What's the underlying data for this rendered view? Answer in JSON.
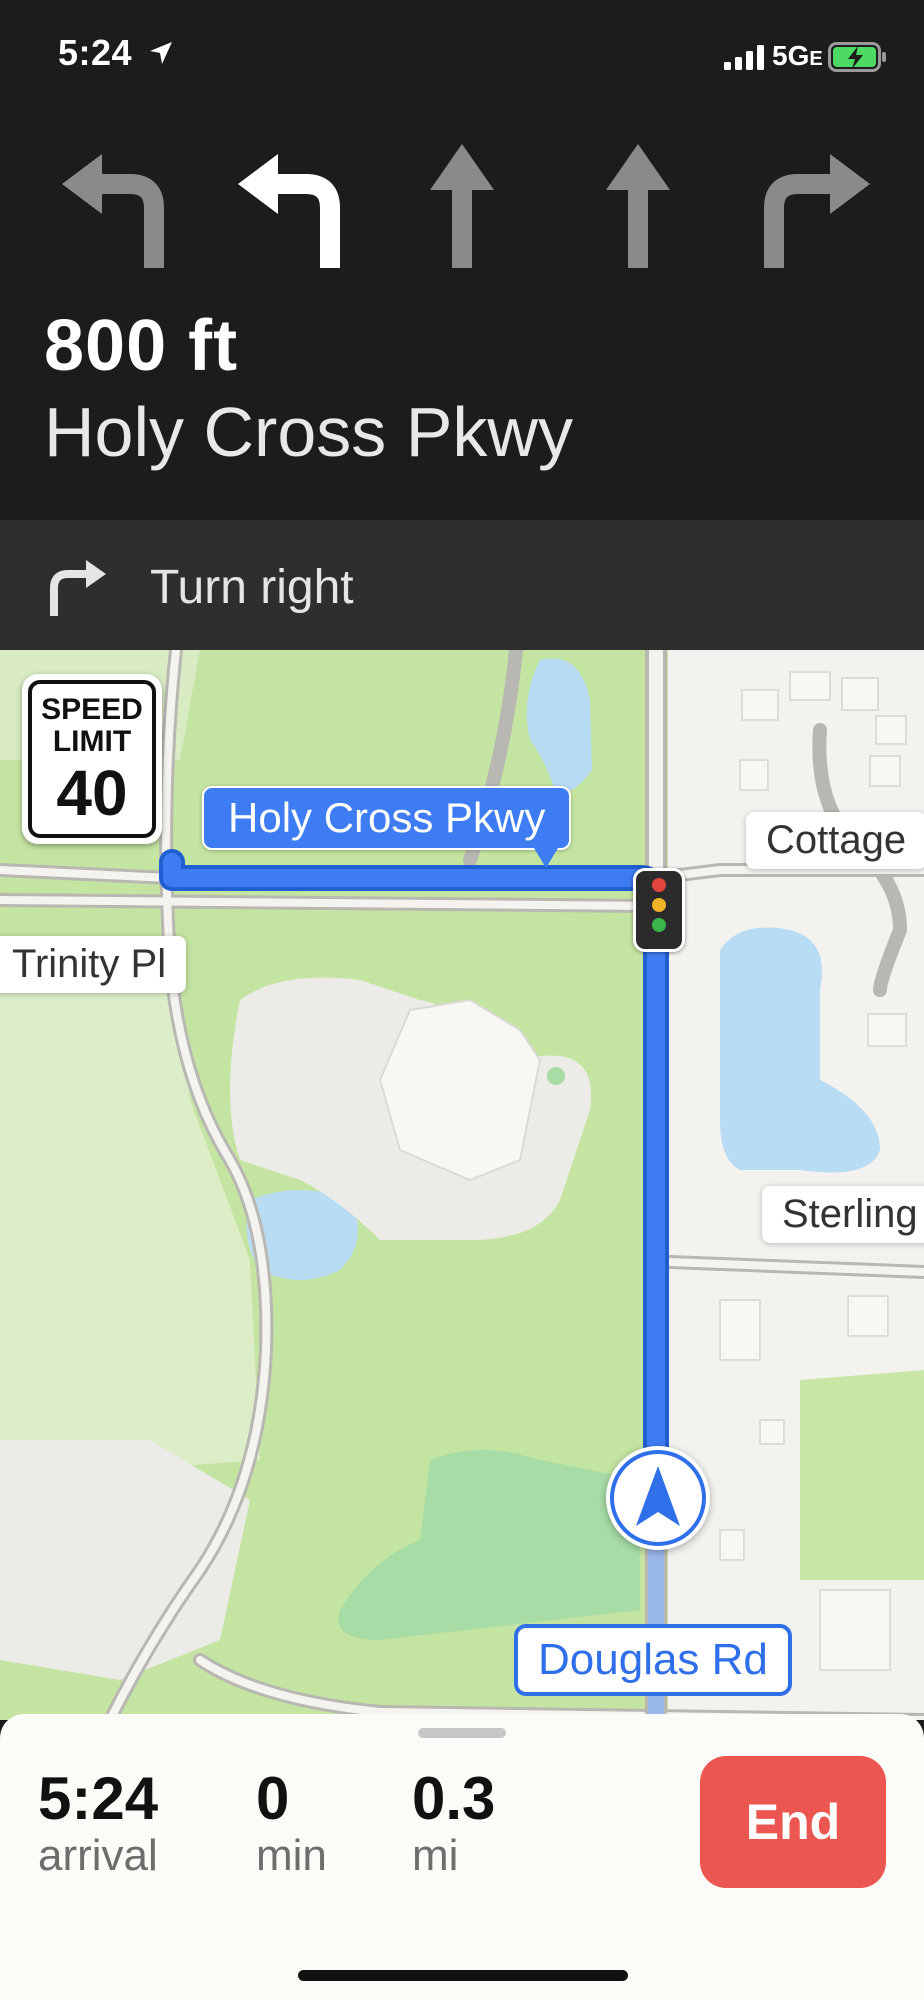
{
  "status_bar": {
    "time": "5:24",
    "network": "5G",
    "network_suffix": "E"
  },
  "guidance": {
    "distance": "800 ft",
    "street": "Holy Cross Pkwy",
    "lanes": [
      "left",
      "left-active",
      "straight",
      "straight",
      "right"
    ]
  },
  "next_maneuver": {
    "text": "Turn right",
    "icon": "turn-right-arrow"
  },
  "speed_sign": {
    "label_line1": "SPEED",
    "label_line2": "LIMIT",
    "value": "40"
  },
  "map": {
    "route_callout": "Holy Cross Pkwy",
    "labels": {
      "cottage": "Cottage",
      "trinity": "Trinity Pl",
      "sterling": "Sterling",
      "douglas": "Douglas Rd"
    }
  },
  "trip": {
    "arrival_value": "5:24",
    "arrival_unit": "arrival",
    "time_value": "0",
    "time_unit": "min",
    "distance_value": "0.3",
    "distance_unit": "mi"
  },
  "end_button": "End",
  "colors": {
    "route": "#3d7cf2",
    "end": "#eb5750",
    "park": "#c4e4a1",
    "water": "#b7dcf4"
  }
}
